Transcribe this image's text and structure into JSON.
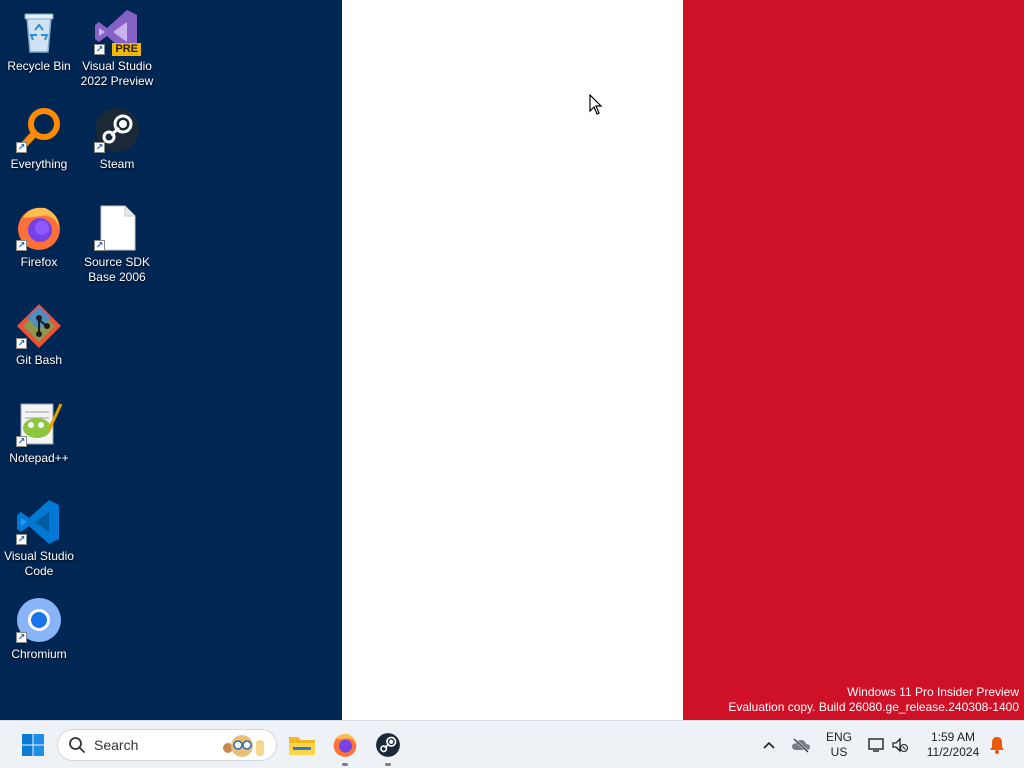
{
  "wallpaper": {
    "colors": {
      "blue": "#002654",
      "white": "#ffffff",
      "red": "#ce1126"
    }
  },
  "desktop": {
    "icons": [
      {
        "label_line1": "Recycle Bin",
        "label_line2": "",
        "icon": "recycle-bin-icon"
      },
      {
        "label_line1": "Visual Studio",
        "label_line2": "2022 Preview",
        "icon": "visual-studio-preview-icon",
        "badge": "PRE"
      },
      {
        "label_line1": "Everything",
        "label_line2": "",
        "icon": "everything-search-icon"
      },
      {
        "label_line1": "Steam",
        "label_line2": "",
        "icon": "steam-icon"
      },
      {
        "label_line1": "Firefox",
        "label_line2": "",
        "icon": "firefox-icon"
      },
      {
        "label_line1": "Source SDK",
        "label_line2": "Base 2006",
        "icon": "blank-file-icon"
      },
      {
        "label_line1": "Git Bash",
        "label_line2": "",
        "icon": "git-bash-icon"
      },
      {
        "label_line1": "Notepad++",
        "label_line2": "",
        "icon": "notepad-plus-plus-icon"
      },
      {
        "label_line1": "Visual Studio",
        "label_line2": "Code",
        "icon": "vscode-icon"
      },
      {
        "label_line1": "Chromium",
        "label_line2": "",
        "icon": "chromium-icon"
      }
    ]
  },
  "watermark": {
    "line1": "Windows 11 Pro Insider Preview",
    "line2": "Evaluation copy. Build 26080.ge_release.240308-1400"
  },
  "taskbar": {
    "search_label": "Search",
    "pinned": [
      "file-explorer-icon",
      "firefox-icon",
      "steam-icon"
    ],
    "tray": {
      "lang_line1": "ENG",
      "lang_line2": "US",
      "time": "1:59 AM",
      "date": "11/2/2024"
    }
  }
}
